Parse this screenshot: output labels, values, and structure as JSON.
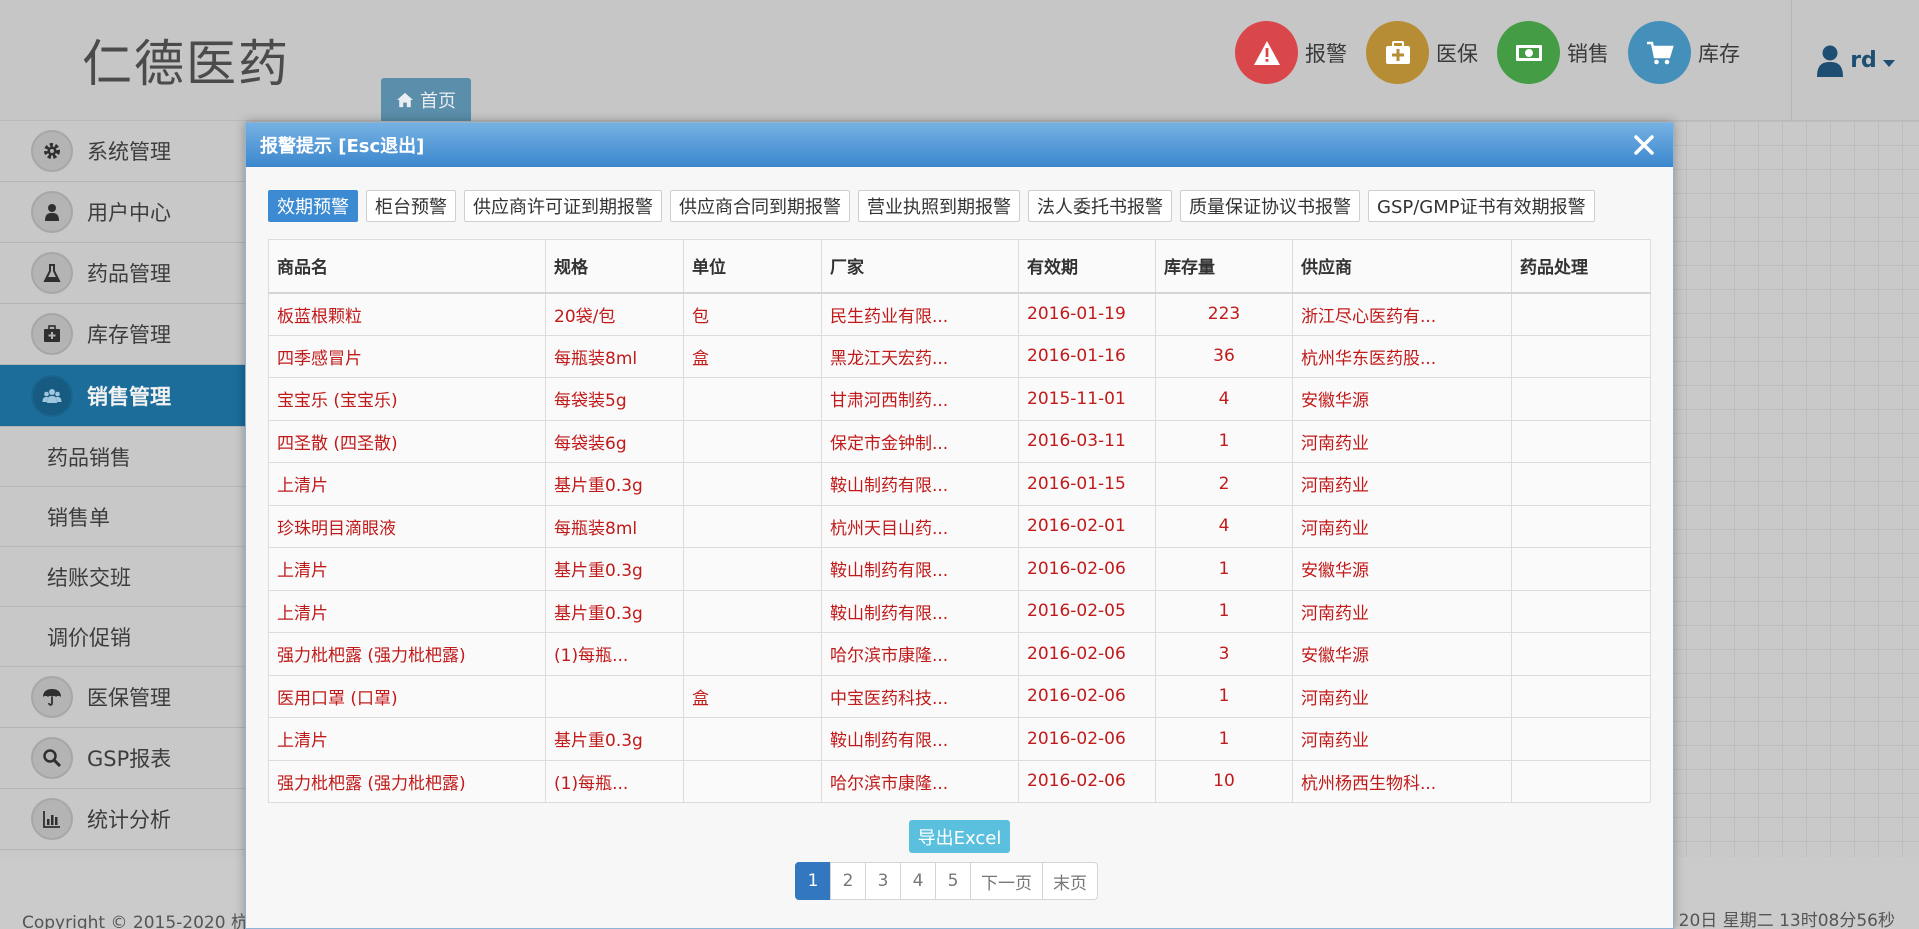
{
  "app": {
    "logo": "仁德医药",
    "home_tab": "首页"
  },
  "top_nav": [
    {
      "label": "报警",
      "color": "#d9474a",
      "icon": "warning-icon"
    },
    {
      "label": "医保",
      "color": "#b68d35",
      "icon": "medkit-icon"
    },
    {
      "label": "销售",
      "color": "#449d44",
      "icon": "money-icon"
    },
    {
      "label": "库存",
      "color": "#4590bb",
      "icon": "cart-icon"
    }
  ],
  "user": {
    "name": "rd"
  },
  "sidebar": {
    "items": [
      {
        "label": "系统管理",
        "icon": "gear-icon"
      },
      {
        "label": "用户中心",
        "icon": "user-icon"
      },
      {
        "label": "药品管理",
        "icon": "flask-icon"
      },
      {
        "label": "库存管理",
        "icon": "medkit-icon"
      },
      {
        "label": "销售管理",
        "icon": "users-icon",
        "active": true
      }
    ],
    "sub_items": [
      "药品销售",
      "销售单",
      "结账交班",
      "调价促销"
    ],
    "items_after": [
      {
        "label": "医保管理",
        "icon": "umbrella-icon"
      },
      {
        "label": "GSP报表",
        "icon": "search-icon"
      },
      {
        "label": "统计分析",
        "icon": "bar-chart-icon"
      }
    ]
  },
  "footer": {
    "copyright": "Copyright © 2015-2020  杭",
    "datetime": "20日 星期二 13时08分56秒"
  },
  "modal": {
    "title": "报警提示 [Esc退出]",
    "tabs": [
      "效期预警",
      "柜台预警",
      "供应商许可证到期报警",
      "供应商合同到期报警",
      "营业执照到期报警",
      "法人委托书报警",
      "质量保证协议书报警",
      "GSP/GMP证书有效期报警"
    ],
    "active_tab": 0,
    "columns": [
      "商品名",
      "规格",
      "单位",
      "厂家",
      "有效期",
      "库存量",
      "供应商",
      "药品处理"
    ],
    "rows": [
      [
        "板蓝根颗粒",
        "20袋/包",
        "包",
        "民生药业有限...",
        "2016-01-19",
        "223",
        "浙江尽心医药有...",
        ""
      ],
      [
        "四季感冒片",
        "每瓶装8ml",
        "盒",
        "黑龙江天宏药...",
        "2016-01-16",
        "36",
        "杭州华东医药股...",
        ""
      ],
      [
        "宝宝乐 (宝宝乐)",
        "每袋装5g",
        "",
        "甘肃河西制药...",
        "2015-11-01",
        "4",
        "安徽华源",
        ""
      ],
      [
        "四圣散 (四圣散)",
        "每袋装6g",
        "",
        "保定市金钟制...",
        "2016-03-11",
        "1",
        "河南药业",
        ""
      ],
      [
        "上清片",
        "基片重0.3g",
        "",
        "鞍山制药有限...",
        "2016-01-15",
        "2",
        "河南药业",
        ""
      ],
      [
        "珍珠明目滴眼液",
        "每瓶装8ml",
        "",
        "杭州天目山药...",
        "2016-02-01",
        "4",
        "河南药业",
        ""
      ],
      [
        "上清片",
        "基片重0.3g",
        "",
        "鞍山制药有限...",
        "2016-02-06",
        "1",
        "安徽华源",
        ""
      ],
      [
        "上清片",
        "基片重0.3g",
        "",
        "鞍山制药有限...",
        "2016-02-05",
        "1",
        "河南药业",
        ""
      ],
      [
        "强力枇杷露 (强力枇杷露)",
        "(1)每瓶...",
        "",
        "哈尔滨市康隆...",
        "2016-02-06",
        "3",
        "安徽华源",
        ""
      ],
      [
        "医用口罩 (口罩)",
        "",
        "盒",
        "中宝医药科技...",
        "2016-02-06",
        "1",
        "河南药业",
        ""
      ],
      [
        "上清片",
        "基片重0.3g",
        "",
        "鞍山制药有限...",
        "2016-02-06",
        "1",
        "河南药业",
        ""
      ],
      [
        "强力枇杷露 (强力枇杷露)",
        "(1)每瓶...",
        "",
        "哈尔滨市康隆...",
        "2016-02-06",
        "10",
        "杭州杨西生物科...",
        ""
      ]
    ],
    "export_label": "导出Excel",
    "pagination": [
      "1",
      "2",
      "3",
      "4",
      "5",
      "下一页",
      "末页"
    ],
    "current_page": "1"
  }
}
